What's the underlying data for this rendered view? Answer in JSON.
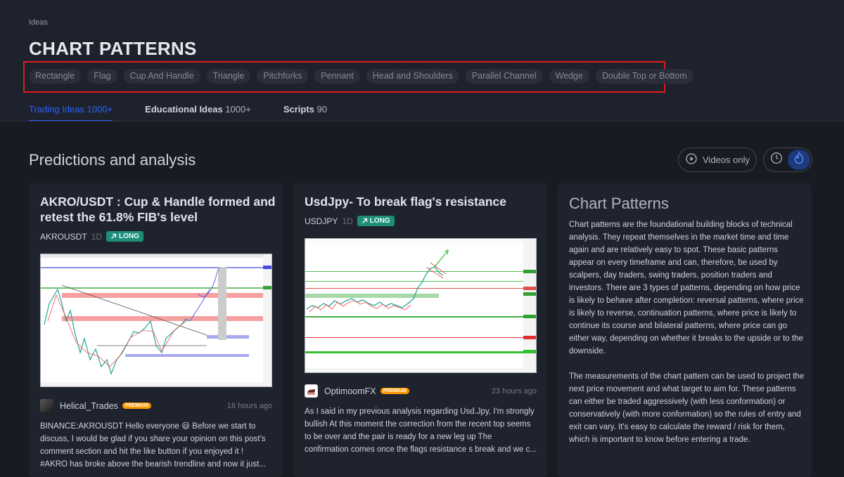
{
  "breadcrumb": "Ideas",
  "page_title": "CHART PATTERNS",
  "pattern_tags": [
    "Rectangle",
    "Flag",
    "Cup And Handle",
    "Triangle",
    "Pitchforks",
    "Pennant",
    "Head and Shoulders",
    "Parallel Channel",
    "Wedge",
    "Double Top or Bottom"
  ],
  "tabs": [
    {
      "label": "Trading Ideas",
      "count": "1000+"
    },
    {
      "label": "Educational Ideas",
      "count": "1000+"
    },
    {
      "label": "Scripts",
      "count": "90"
    }
  ],
  "section_title": "Predictions and analysis",
  "videos_only_label": "Videos only",
  "cards": [
    {
      "title": "AKRO/USDT : Cup & Handle formed and retest the 61.8% FIB's level",
      "symbol": "AKROUSDT",
      "interval": "1D",
      "direction": "LONG",
      "author": "Helical_Trades",
      "badge": "PREMIUM",
      "time": "18 hours ago",
      "description": "BINANCE:AKROUSDT Hello everyone 😃 Before we start to discuss, I would be glad if you share your opinion on this post's comment section and hit the like button if you enjoyed it ! #AKRO has broke above the bearish trendline and now it just..."
    },
    {
      "title": "UsdJpy- To break flag's resistance",
      "symbol": "USDJPY",
      "interval": "1D",
      "direction": "LONG",
      "author": "OptimoomFX",
      "badge": "PREMIUM",
      "time": "23 hours ago",
      "description": "As I said in my previous analysis regarding Usd.Jpy, I'm strongly bullish At this moment the correction from the recent top seems to be over and the pair is ready for a new leg up The confirmation comes once the flags resistance s break and we c..."
    }
  ],
  "info_card": {
    "title": "Chart Patterns",
    "paragraphs": [
      "Chart patterns are the foundational building blocks of technical analysis. They repeat themselves in the market time and time again and are relatively easy to spot. These basic patterns appear on every timeframe and can, therefore, be used by scalpers, day traders, swing traders, position traders and investors. There are 3 types of patterns, depending on how price is likely to behave after completion: reversal patterns, where price is likely to reverse, continuation patterns, where price is likely to continue its course and bilateral patterns, where price can go either way, depending on whether it breaks to the upside or to the downside.",
      "The measurements of the chart pattern can be used to project the next price movement and what target to aim for. These patterns can either be traded aggressively (with less conformation) or conservatively (with more conformation) so the rules of entry and exit can vary. It's easy to calculate the reward / risk for them, which is important to know before entering a trade."
    ]
  },
  "colors": {
    "accent": "#2962ff",
    "long_badge": "#1e8d7a",
    "premium": "#ff9800",
    "highlight_box": "#e01b1b"
  }
}
